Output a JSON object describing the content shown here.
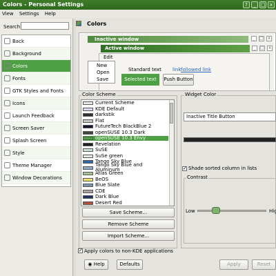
{
  "window": {
    "title": "Colors - Personal Settings",
    "controls": [
      "?",
      "_",
      "□",
      "x"
    ]
  },
  "menubar": [
    "View",
    "Settings",
    "Help"
  ],
  "sidebar": {
    "search_label": "Search:",
    "search_value": "",
    "items": [
      {
        "label": "Back",
        "icon": "back-icon"
      },
      {
        "label": "Background",
        "icon": "background-icon"
      },
      {
        "label": "Colors",
        "icon": "colors-icon",
        "selected": true
      },
      {
        "label": "Fonts",
        "icon": "fonts-icon"
      },
      {
        "label": "GTK Styles and Fonts",
        "icon": "gtk-icon"
      },
      {
        "label": "Icons",
        "icon": "icons-icon"
      },
      {
        "label": "Launch Feedback",
        "icon": "launch-icon"
      },
      {
        "label": "Screen Saver",
        "icon": "screensaver-icon"
      },
      {
        "label": "Splash Screen",
        "icon": "splash-icon"
      },
      {
        "label": "Style",
        "icon": "style-icon"
      },
      {
        "label": "Theme Manager",
        "icon": "theme-icon"
      },
      {
        "label": "Window Decorations",
        "icon": "decorations-icon"
      }
    ]
  },
  "main": {
    "title": "Colors",
    "preview": {
      "inactive_title": "Inactive window",
      "active_title": "Active window",
      "menu_edit": "Edit",
      "menu_items": [
        "New",
        "Open",
        "Save"
      ],
      "standard_text": "Standard text",
      "link": "link",
      "followed_link": "followed link",
      "selected_text": "Selected text",
      "push_button": "Push Button"
    },
    "color_scheme": {
      "label": "Color Scheme",
      "schemes": [
        {
          "name": "Current Scheme",
          "color": "#e8e8e8"
        },
        {
          "name": "KDE Default",
          "color": "#d8d8f0"
        },
        {
          "name": "darkstik",
          "color": "#303030"
        },
        {
          "name": "Flat",
          "color": "#c8c8c8"
        },
        {
          "name": "FutureTech BlackBlue 2",
          "color": "#101830"
        },
        {
          "name": "openSUSE 10.3 Dark",
          "color": "#404840"
        },
        {
          "name": "openSUSE 10.3 Envy",
          "color": "#4fa044",
          "selected": true
        },
        {
          "name": "Revelation",
          "color": "#202020"
        },
        {
          "name": "SuSE",
          "color": "#d0e0d0"
        },
        {
          "name": "SuSe green",
          "color": "#e0ecdf"
        },
        {
          "name": "Tango Sky Blue",
          "color": "#3465a4"
        },
        {
          "name": "Tango Sky Blue and Aluminum",
          "color": "#8aa8c8"
        },
        {
          "name": "Atlas Green",
          "color": "#a8c090"
        },
        {
          "name": "BeOS",
          "color": "#f0e070"
        },
        {
          "name": "Blue Slate",
          "color": "#8090b0"
        },
        {
          "name": "CDE",
          "color": "#b0a0a0"
        },
        {
          "name": "Dark Blue",
          "color": "#203060"
        },
        {
          "name": "Desert Red",
          "color": "#b05040"
        }
      ],
      "save_button": "Save Scheme...",
      "remove_button": "Remove Scheme",
      "import_button": "Import Scheme..."
    },
    "widget_color": {
      "label": "Widget Color",
      "selected": "Inactive Title Button",
      "swatch_color": "#222222",
      "shade_sorted_label": "Shade sorted column in lists",
      "shade_sorted_checked": true,
      "contrast_label": "Contrast",
      "contrast_low": "Low",
      "contrast_high": "High",
      "contrast_level": 0.27
    },
    "apply_nonkde_label": "Apply colors to non-KDE applications",
    "apply_nonkde_checked": true
  },
  "footer": {
    "help": "Help",
    "defaults": "Defaults",
    "apply": "Apply",
    "reset": "Reset"
  },
  "colors": {
    "accent": "#4fa044",
    "titlebar": "#2d6a1d"
  }
}
